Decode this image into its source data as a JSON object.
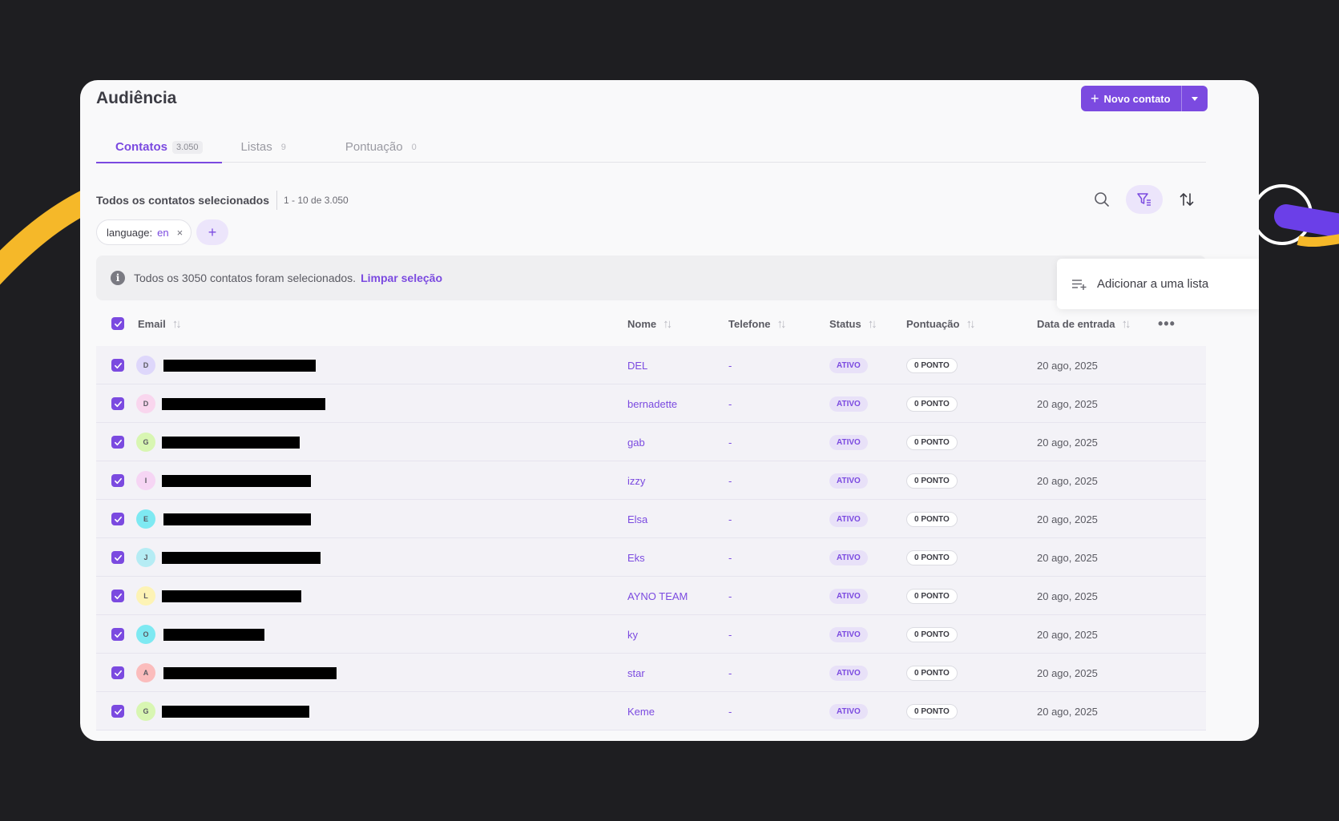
{
  "page": {
    "title": "Audiência",
    "new_contact_label": "Novo contato"
  },
  "tabs": [
    {
      "label": "Contatos",
      "count": "3.050"
    },
    {
      "label": "Listas",
      "count": "9"
    },
    {
      "label": "Pontuação",
      "count": "0"
    }
  ],
  "selection": {
    "label": "Todos os contatos selecionados",
    "range": "1 - 10 de 3.050"
  },
  "filter_chip": {
    "key": "language:",
    "value": "en",
    "remove": "×"
  },
  "add_filter": "+",
  "banner": {
    "text": "Todos os 3050 contatos foram selecionados.",
    "link": "Limpar seleção"
  },
  "menu": {
    "item": "Adicionar a uma lista"
  },
  "columns": {
    "email": "Email",
    "name": "Nome",
    "phone": "Telefone",
    "status": "Status",
    "points": "Pontuação",
    "joined": "Data de entrada",
    "more": "•••"
  },
  "colors": {
    "accent": "#7b4ae0",
    "avatar_palette": [
      "#ded7fb",
      "#f9d6ee",
      "#d8f6b2",
      "#f6d5f4",
      "#7ee9f2",
      "#b5ecf4",
      "#fdf3b5",
      "#7ee9f2",
      "#fbbcbc",
      "#d8f6b2"
    ]
  },
  "rows": [
    {
      "initial": "D",
      "name": "DEL",
      "phone": "-",
      "status": "ATIVO",
      "points": "0 PONTO",
      "date": "20 ago, 2025"
    },
    {
      "initial": "D",
      "name": "bernadette",
      "phone": "-",
      "status": "ATIVO",
      "points": "0 PONTO",
      "date": "20 ago, 2025"
    },
    {
      "initial": "G",
      "name": "gab",
      "phone": "-",
      "status": "ATIVO",
      "points": "0 PONTO",
      "date": "20 ago, 2025"
    },
    {
      "initial": "I",
      "name": "izzy",
      "phone": "-",
      "status": "ATIVO",
      "points": "0 PONTO",
      "date": "20 ago, 2025"
    },
    {
      "initial": "E",
      "name": "Elsa",
      "phone": "-",
      "status": "ATIVO",
      "points": "0 PONTO",
      "date": "20 ago, 2025"
    },
    {
      "initial": "J",
      "name": "Eks",
      "phone": "-",
      "status": "ATIVO",
      "points": "0 PONTO",
      "date": "20 ago, 2025"
    },
    {
      "initial": "L",
      "name": "AYNO TEAM",
      "phone": "-",
      "status": "ATIVO",
      "points": "0 PONTO",
      "date": "20 ago, 2025"
    },
    {
      "initial": "O",
      "name": "ky",
      "phone": "-",
      "status": "ATIVO",
      "points": "0 PONTO",
      "date": "20 ago, 2025"
    },
    {
      "initial": "A",
      "name": "star",
      "phone": "-",
      "status": "ATIVO",
      "points": "0 PONTO",
      "date": "20 ago, 2025"
    },
    {
      "initial": "G",
      "name": "Keme",
      "phone": "-",
      "status": "ATIVO",
      "points": "0 PONTO",
      "date": "20 ago, 2025"
    }
  ]
}
